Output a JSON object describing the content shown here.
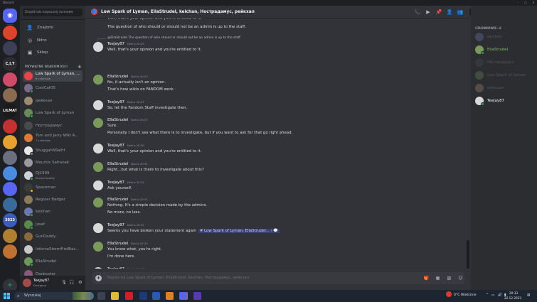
{
  "window": {
    "app_name": "Discord",
    "controls": [
      "–",
      "□",
      "✕"
    ]
  },
  "sidebar_servers": {
    "items": [
      {
        "name": "home",
        "color": "#5865f2"
      },
      {
        "name": "server-1",
        "color": "#e0432b"
      },
      {
        "name": "server-2",
        "color": "#3d3f56"
      },
      {
        "name": "C,I,T",
        "color": "#2b2d31"
      },
      {
        "name": "server-4",
        "color": "#d04a6a"
      },
      {
        "name": "server-5",
        "color": "#8a6a50"
      },
      {
        "name": "LILMAT",
        "color": "#1a1a1a"
      },
      {
        "name": "server-7",
        "color": "#c73030"
      },
      {
        "name": "server-8",
        "color": "#e5a030"
      },
      {
        "name": "server-9",
        "color": "#6a7080"
      },
      {
        "name": "server-10",
        "color": "#4a8ae0"
      },
      {
        "name": "server-11",
        "color": "#5865f2"
      },
      {
        "name": "server-12",
        "color": "#3a6a9a"
      },
      {
        "name": "2023",
        "color": "#3a5cc0"
      },
      {
        "name": "server-14",
        "color": "#b08030"
      },
      {
        "name": "server-15",
        "color": "#c07030"
      }
    ]
  },
  "channels": {
    "search_placeholder": "Znajdź lub rozpocznij rozmowę",
    "nav": [
      {
        "label": "Znajomi",
        "icon": "friends-icon"
      },
      {
        "label": "Nitro",
        "icon": "nitro-icon"
      },
      {
        "label": "Sklep",
        "icon": "shop-icon"
      }
    ],
    "dm_header": "PRYWATNE WIADOMOŚCI",
    "dms": [
      {
        "name": "Low Spark of Lyman, ...",
        "sub": "6 członków",
        "color": "#ed4245",
        "active": true
      },
      {
        "name": "CoolCat05",
        "sub": "",
        "color": "#7a6a8a",
        "status": "#23a55a"
      },
      {
        "name": "рейкхал",
        "sub": "",
        "color": "#a08a70",
        "status": ""
      },
      {
        "name": "Low Spark of Lyman",
        "sub": "",
        "color": "#6a8a5a",
        "status": "#23a55a"
      },
      {
        "name": "Ностpадамус",
        "sub": "",
        "color": "#4a4a4a",
        "status": ""
      },
      {
        "name": "Tom and Jerry Wiki A...",
        "sub": "7 członków",
        "color": "#e07a30"
      },
      {
        "name": "ShuggahNSalht",
        "sub": "",
        "color": "#e8e8e8",
        "status": "#80848e"
      },
      {
        "name": "Maurice Safranek",
        "sub": "",
        "color": "#9a9aa0",
        "status": ""
      },
      {
        "name": "DJ1999",
        "sub": "Słucha Spotify",
        "color": "#d0d0d8",
        "status": "#23a55a"
      },
      {
        "name": "Spaceman",
        "sub": "",
        "color": "#3a3a3a",
        "status": "#f0b232"
      },
      {
        "name": "Regular Badger",
        "sub": "",
        "color": "#8a7a5a",
        "status": ""
      },
      {
        "name": "keichan",
        "sub": "",
        "color": "#6a7ab0",
        "status": "#23a55a"
      },
      {
        "name": "Josef",
        "sub": "",
        "color": "#5a8a4a",
        "status": "#23a55a"
      },
      {
        "name": "GunDaddy",
        "sub": "",
        "color": "#8a6a3a",
        "status": ""
      },
      {
        "name": "InfernoStormFireBlas...",
        "sub": "",
        "color": "#c8c8c8",
        "status": ""
      },
      {
        "name": "EllaStrudel",
        "sub": "",
        "color": "#6a9a5a",
        "status": "#23a55a"
      },
      {
        "name": "Danbuster",
        "sub": "",
        "color": "#8a5a7a",
        "status": ""
      }
    ]
  },
  "user_panel": {
    "name": "TeeJay87",
    "status": "Dostępny"
  },
  "header": {
    "title": "Low Spark of Lyman, EllaStrudel, keichan, Ностpадамус, рейкхал",
    "search_placeholder": "Szukaj"
  },
  "messages": [
    {
      "type": "cont",
      "text": "Well, that's your opinion and you're entitled to it."
    },
    {
      "type": "cont",
      "text": "The question of who should or should not be an admin is up to the staff."
    },
    {
      "type": "reply",
      "reply_to": "@EllaStrudel The question of who should or should not be an admin is up to the staff",
      "author": "TeeJay87",
      "time": "Dziś o 20:23",
      "lines": [
        "Well, that's your opinion and you're entitled to it."
      ],
      "color": "#d8d8d8"
    },
    {
      "type": "msg",
      "author": "EllaStrudel",
      "time": "Dziś o 20:23",
      "lines": [
        "No, it actually isn't an opinion.",
        "That's how wikis on FANDOM work."
      ],
      "color": "#7a9a5a"
    },
    {
      "type": "msg",
      "author": "TeeJay87",
      "time": "Dziś o 20:27",
      "lines": [
        "So, let the Fandom Staff investigate then."
      ],
      "color": "#d8d8d8"
    },
    {
      "type": "msg",
      "author": "EllaStrudel",
      "time": "Dziś o 20:27",
      "lines": [
        "Sure.",
        "Personally I don't see what there is to investigate, but if you want to ask for that go right ahead."
      ],
      "color": "#7a9a5a"
    },
    {
      "type": "msg",
      "author": "TeeJay87",
      "time": "Dziś o 20:30",
      "lines": [
        "Well, that's your opinion and you're entitled to it."
      ],
      "color": "#d8d8d8"
    },
    {
      "type": "msg",
      "author": "EllaStrudel",
      "time": "Dziś o 20:31",
      "lines": [
        "Right...but what is there to investigate about this?"
      ],
      "color": "#7a9a5a"
    },
    {
      "type": "msg",
      "author": "TeeJay87",
      "time": "Dziś o 20:31",
      "lines": [
        "Ask yourself."
      ],
      "color": "#d8d8d8"
    },
    {
      "type": "msg",
      "author": "EllaStrudel",
      "time": "Dziś o 20:31",
      "lines": [
        "Nothing. It's a simple decision made by the admins.",
        "No more, no less."
      ],
      "color": "#7a9a5a"
    },
    {
      "type": "msg",
      "author": "TeeJay87",
      "time": "Dziś o 20:32",
      "lines": [
        "Seems you have broken your statement again"
      ],
      "mention": "# Low Spark of Lyman, EllaStrudel... › 💬",
      "color": "#d8d8d8"
    },
    {
      "type": "msg",
      "author": "EllaStrudel",
      "time": "Dziś o 20:32",
      "lines": [
        "You know what, you're right.",
        "I'm done here."
      ],
      "color": "#7a9a5a"
    },
    {
      "type": "msg",
      "author": "TeeJay87",
      "time": "Dziś o 20:33",
      "lines": [
        "Good."
      ],
      "color": "#d8d8d8"
    }
  ],
  "composer": {
    "placeholder": "Napisz na Low Spark of Lyman, EllaStrudel, keichan, Ностpадамус, рейкхал"
  },
  "members": {
    "header": "CZŁONKOWIE—6",
    "list": [
      {
        "name": "keichan",
        "color": "#6a7ab0",
        "online": false
      },
      {
        "name": "EllaStrudel",
        "color": "#7a9a5a",
        "online": true,
        "status": "#23a55a"
      },
      {
        "name": "Ностpадамус",
        "color": "#4a4a4a",
        "online": false
      },
      {
        "name": "Low Spark of Lyman",
        "color": "#6a8a5a",
        "online": false
      },
      {
        "name": "рейкхал",
        "color": "#a08a70",
        "online": false
      },
      {
        "name": "TeeJay87",
        "color": "#d8d8d8",
        "online": true,
        "status": "#23a55a"
      }
    ]
  },
  "taskbar": {
    "search_placeholder": "Wyszukaj",
    "weather": "0°C Wietrznie",
    "time": "20:33",
    "date": "22.12.2023",
    "apps": [
      {
        "name": "task-view",
        "color": "#3a4450"
      },
      {
        "name": "file-explorer",
        "color": "#e8b830"
      },
      {
        "name": "acrobat",
        "color": "#d02020"
      },
      {
        "name": "photoshop",
        "color": "#1a3a7a"
      },
      {
        "name": "word",
        "color": "#2a5ab0"
      },
      {
        "name": "vlc",
        "color": "#e08020"
      },
      {
        "name": "firefox",
        "color": "#e0602a"
      },
      {
        "name": "app-ms",
        "color": "#5a3ab0"
      },
      {
        "name": "discord",
        "color": "#5865f2"
      }
    ]
  }
}
